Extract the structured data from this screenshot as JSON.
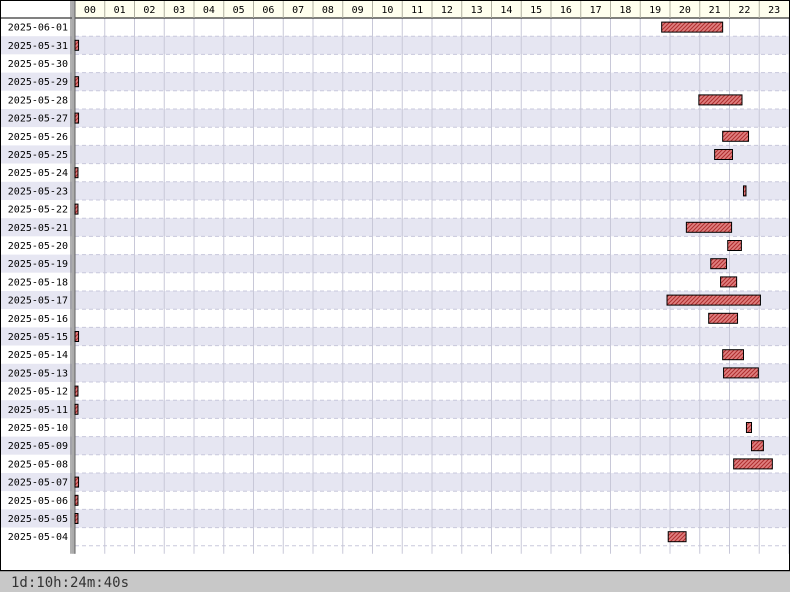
{
  "chart_data": {
    "type": "gantt",
    "xlabel": "",
    "ylabel": "",
    "x_ticks": [
      "00",
      "01",
      "02",
      "03",
      "04",
      "05",
      "06",
      "07",
      "08",
      "09",
      "10",
      "11",
      "12",
      "13",
      "14",
      "15",
      "16",
      "17",
      "18",
      "19",
      "20",
      "21",
      "22",
      "23"
    ],
    "xlim": [
      0,
      24
    ],
    "grid": true,
    "rows": [
      {
        "date": "2025-06-01",
        "start": 19.72,
        "end": 21.77
      },
      {
        "date": "2025-05-31",
        "start": 0.0,
        "end": 0.12
      },
      {
        "date": "2025-05-30",
        "start": 0.0,
        "end": 0.0
      },
      {
        "date": "2025-05-29",
        "start": 0.0,
        "end": 0.12
      },
      {
        "date": "2025-05-28",
        "start": 20.97,
        "end": 22.42
      },
      {
        "date": "2025-05-27",
        "start": 0.0,
        "end": 0.12
      },
      {
        "date": "2025-05-26",
        "start": 21.77,
        "end": 22.64
      },
      {
        "date": "2025-05-25",
        "start": 21.5,
        "end": 22.1
      },
      {
        "date": "2025-05-24",
        "start": 0.0,
        "end": 0.1
      },
      {
        "date": "2025-05-23",
        "start": 22.47,
        "end": 22.55
      },
      {
        "date": "2025-05-22",
        "start": 0.0,
        "end": 0.1
      },
      {
        "date": "2025-05-21",
        "start": 20.55,
        "end": 22.07
      },
      {
        "date": "2025-05-20",
        "start": 21.94,
        "end": 22.4
      },
      {
        "date": "2025-05-19",
        "start": 21.37,
        "end": 21.9
      },
      {
        "date": "2025-05-18",
        "start": 21.7,
        "end": 22.24
      },
      {
        "date": "2025-05-17",
        "start": 19.9,
        "end": 23.04
      },
      {
        "date": "2025-05-16",
        "start": 21.3,
        "end": 22.27
      },
      {
        "date": "2025-05-15",
        "start": 0.0,
        "end": 0.12
      },
      {
        "date": "2025-05-14",
        "start": 21.77,
        "end": 22.47
      },
      {
        "date": "2025-05-13",
        "start": 21.8,
        "end": 22.97
      },
      {
        "date": "2025-05-12",
        "start": 0.0,
        "end": 0.1
      },
      {
        "date": "2025-05-11",
        "start": 0.0,
        "end": 0.1
      },
      {
        "date": "2025-05-10",
        "start": 22.57,
        "end": 22.74
      },
      {
        "date": "2025-05-09",
        "start": 22.74,
        "end": 23.14
      },
      {
        "date": "2025-05-08",
        "start": 22.14,
        "end": 23.44
      },
      {
        "date": "2025-05-07",
        "start": 0.0,
        "end": 0.12
      },
      {
        "date": "2025-05-06",
        "start": 0.0,
        "end": 0.1
      },
      {
        "date": "2025-05-05",
        "start": 0.0,
        "end": 0.1
      },
      {
        "date": "2025-05-04",
        "start": 19.94,
        "end": 20.54
      }
    ],
    "colors": {
      "bar_fill": "#e08080",
      "bar_hatch": "#b03030",
      "bar_stroke": "#000000",
      "row_even": "#ffffff",
      "row_odd": "#e6e6f2",
      "header_bg": "#ffffee",
      "grid": "#c8c8d8",
      "axis": "#606060"
    },
    "total_label": "1d:10h:24m:40s"
  }
}
